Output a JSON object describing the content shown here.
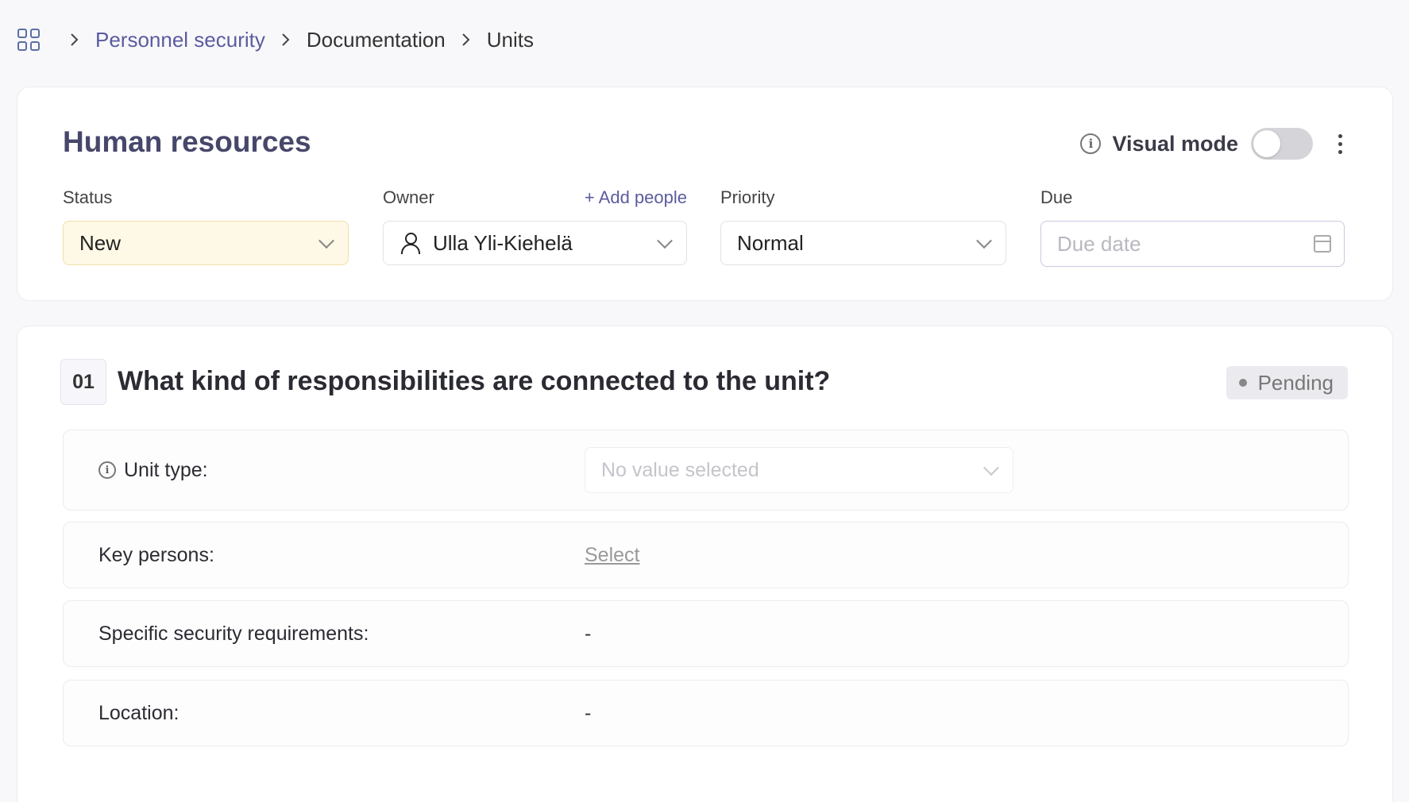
{
  "breadcrumb": {
    "items": [
      "Personnel security",
      "Documentation",
      "Units"
    ]
  },
  "header": {
    "title": "Human resources",
    "visual_mode_label": "Visual mode",
    "visual_mode_on": false
  },
  "fields": {
    "status": {
      "label": "Status",
      "value": "New"
    },
    "owner": {
      "label": "Owner",
      "add_people": "+ Add people",
      "value": "Ulla Yli-Kiehelä"
    },
    "priority": {
      "label": "Priority",
      "value": "Normal"
    },
    "due": {
      "label": "Due",
      "placeholder": "Due date"
    }
  },
  "question": {
    "number": "01",
    "title": "What kind of responsibilities are connected to the unit?",
    "status": "Pending",
    "rows": [
      {
        "label": "Unit type:",
        "value": "No value selected"
      },
      {
        "label": "Key persons:",
        "value": "Select"
      },
      {
        "label": "Specific security requirements:",
        "value": "-"
      },
      {
        "label": "Location:",
        "value": "-"
      }
    ]
  },
  "colors": {
    "accent": "#5b5ba0",
    "status_bg": "#fef8e6",
    "title": "#47476b"
  }
}
